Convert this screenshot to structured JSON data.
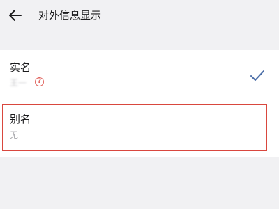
{
  "header": {
    "title": "对外信息显示",
    "back_icon": "arrow-left-icon"
  },
  "options": [
    {
      "label": "实名",
      "sub_text": "王一",
      "help_icon": "question-circle-icon",
      "help_text": "?",
      "selected": true,
      "selected_icon": "checkmark-icon"
    },
    {
      "label": "别名",
      "sub_text": "无",
      "selected": false
    }
  ],
  "colors": {
    "accent": "#4a6da7",
    "highlight": "#d9473e",
    "help": "#e0605a"
  }
}
